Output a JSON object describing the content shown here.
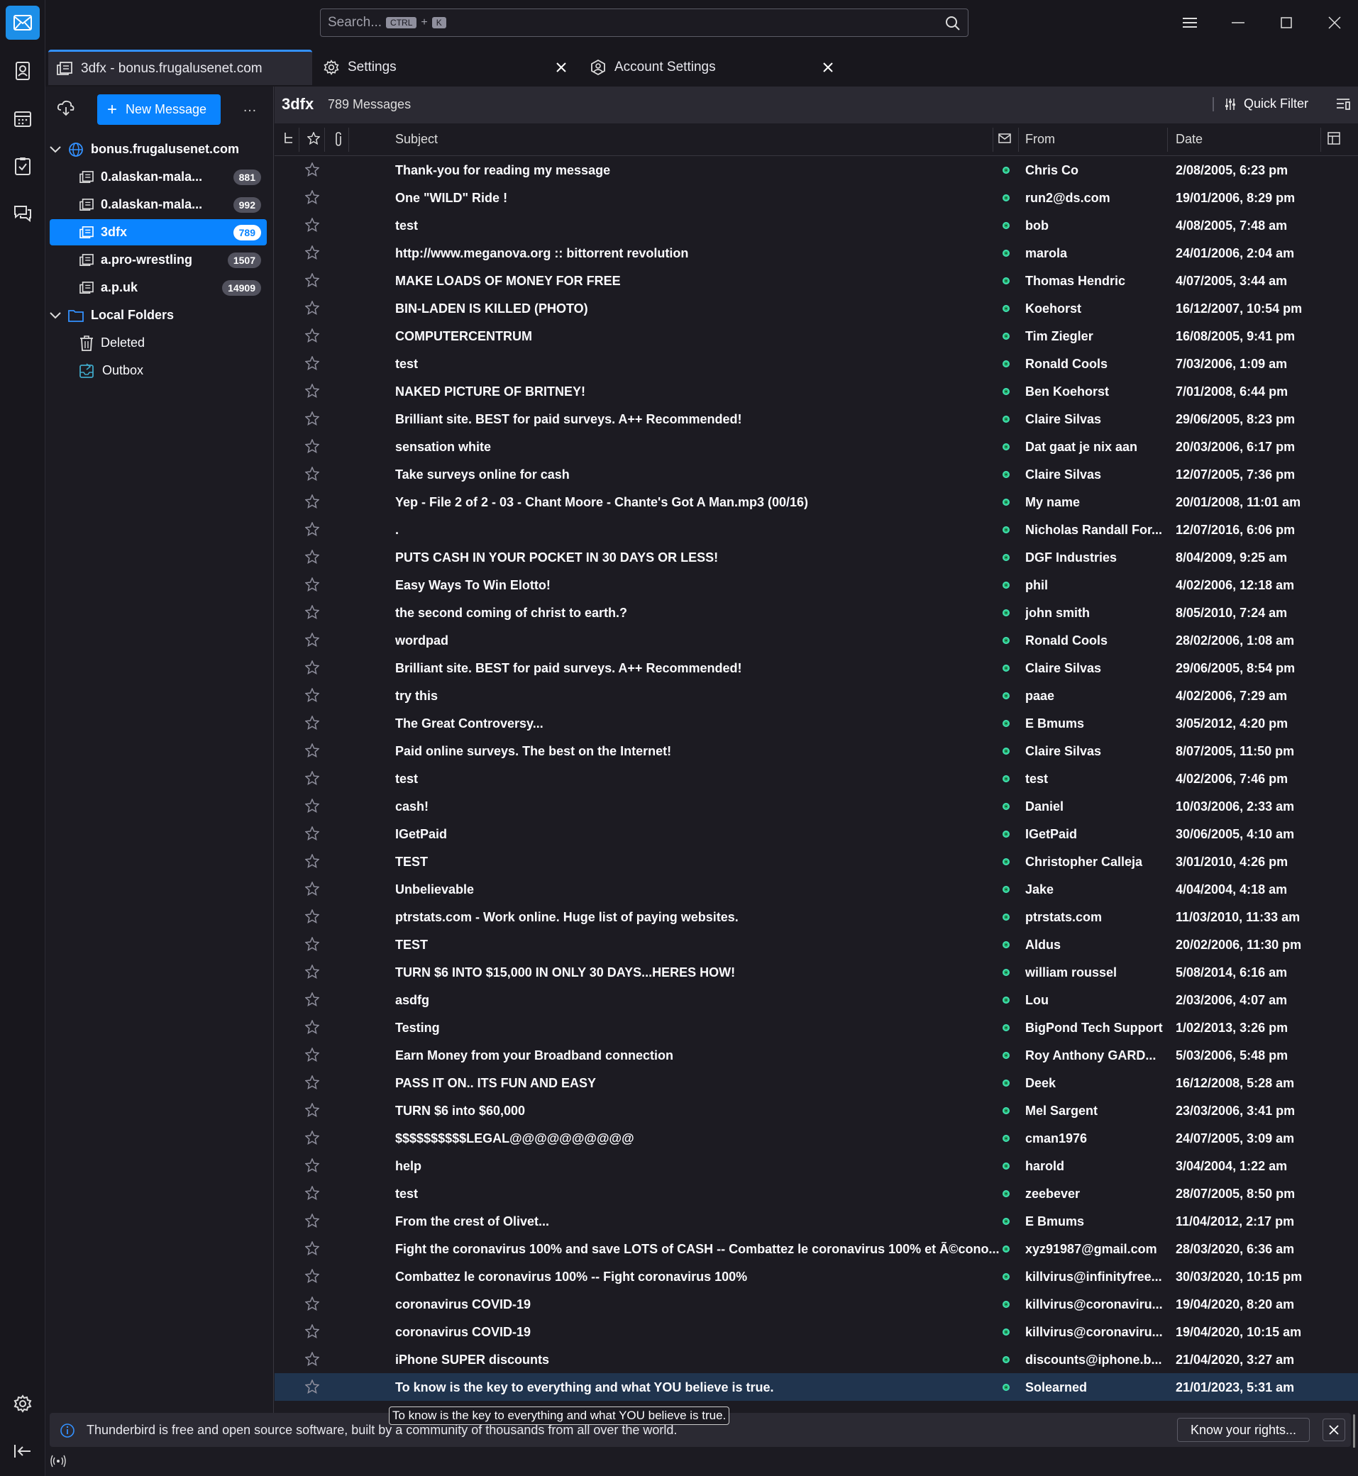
{
  "search": {
    "placeholder": "Search...",
    "shortcut_mod": "CTRL",
    "shortcut_plus": "+",
    "shortcut_key": "K"
  },
  "tabs": [
    {
      "label": "3dfx - bonus.frugalusenet.com",
      "icon": "newsgroup-icon"
    },
    {
      "label": "Settings",
      "icon": "gear-icon"
    },
    {
      "label": "Account Settings",
      "icon": "account-icon"
    }
  ],
  "folderpane": {
    "new_message": "New Message",
    "more": "…",
    "folders": [
      {
        "label": "bonus.frugalusenet.com",
        "type": "server",
        "bold": true
      },
      {
        "label": "0.alaskan-mala...",
        "badge": "881",
        "bold": true
      },
      {
        "label": "0.alaskan-mala...",
        "badge": "992",
        "bold": true
      },
      {
        "label": "3dfx",
        "badge": "789",
        "bold": true,
        "selected": true
      },
      {
        "label": "a.pro-wrestling",
        "badge": "1507",
        "bold": true
      },
      {
        "label": "a.p.uk",
        "badge": "14909",
        "bold": true
      },
      {
        "label": "Local Folders",
        "type": "local",
        "bold": true
      },
      {
        "label": "Deleted",
        "type": "trash"
      },
      {
        "label": "Outbox",
        "type": "outbox"
      }
    ]
  },
  "threadpane": {
    "folder_name": "3dfx",
    "message_count": "789 Messages",
    "quick_filter": "Quick Filter",
    "columns": {
      "subject": "Subject",
      "from": "From",
      "date": "Date"
    },
    "messages": [
      {
        "subject": "Thank-you for reading my message",
        "from": "Chris Co",
        "date": "2/08/2005, 6:23 pm"
      },
      {
        "subject": "One \"WILD\" Ride !",
        "from": "run2@ds.com",
        "date": "19/01/2006, 8:29 pm"
      },
      {
        "subject": "test",
        "from": "bob",
        "date": "4/08/2005, 7:48 am"
      },
      {
        "subject": "http://www.meganova.org :: bittorrent revolution",
        "from": "marola",
        "date": "24/01/2006, 2:04 am"
      },
      {
        "subject": "MAKE LOADS OF MONEY FOR FREE",
        "from": "Thomas Hendric",
        "date": "4/07/2005, 3:44 am"
      },
      {
        "subject": "BIN-LADEN IS KILLED (PHOTO)",
        "from": "Koehorst",
        "date": "16/12/2007, 10:54 pm"
      },
      {
        "subject": "COMPUTERCENTRUM",
        "from": "Tim Ziegler",
        "date": "16/08/2005, 9:41 pm"
      },
      {
        "subject": "test",
        "from": "Ronald Cools",
        "date": "7/03/2006, 1:09 am"
      },
      {
        "subject": "NAKED PICTURE OF BRITNEY!",
        "from": "Ben Koehorst",
        "date": "7/01/2008, 6:44 pm"
      },
      {
        "subject": "Brilliant site. BEST for paid surveys. A++ Recommended!",
        "from": "Claire Silvas",
        "date": "29/06/2005, 8:23 pm"
      },
      {
        "subject": "sensation white",
        "from": "Dat gaat je nix aan",
        "date": "20/03/2006, 6:17 pm"
      },
      {
        "subject": "Take surveys online for cash",
        "from": "Claire Silvas",
        "date": "12/07/2005, 7:36 pm"
      },
      {
        "subject": "Yep - File 2 of 2 - 03 - Chant Moore - Chante's Got A Man.mp3 (00/16)",
        "from": "My name",
        "date": "20/01/2008, 11:01 am"
      },
      {
        "subject": ".",
        "from": "Nicholas Randall For...",
        "date": "12/07/2016, 6:06 pm"
      },
      {
        "subject": "PUTS CASH IN YOUR POCKET IN 30 DAYS OR LESS!",
        "from": "DGF Industries",
        "date": "8/04/2009, 9:25 am"
      },
      {
        "subject": "Easy Ways To Win Elotto!",
        "from": "phil",
        "date": "4/02/2006, 12:18 am"
      },
      {
        "subject": "the second coming of christ to earth.?",
        "from": "john smith",
        "date": "8/05/2010, 7:24 am"
      },
      {
        "subject": "wordpad",
        "from": "Ronald Cools",
        "date": "28/02/2006, 1:08 am"
      },
      {
        "subject": "Brilliant site. BEST for paid surveys. A++ Recommended!",
        "from": "Claire Silvas",
        "date": "29/06/2005, 8:54 pm"
      },
      {
        "subject": "try this",
        "from": "paae",
        "date": "4/02/2006, 7:29 am"
      },
      {
        "subject": "The Great Controversy...",
        "from": "E Bmums",
        "date": "3/05/2012, 4:20 pm"
      },
      {
        "subject": "Paid online surveys. The best on the Internet!",
        "from": "Claire Silvas",
        "date": "8/07/2005, 11:50 pm"
      },
      {
        "subject": "test",
        "from": "test",
        "date": "4/02/2006, 7:46 pm"
      },
      {
        "subject": "cash!",
        "from": "Daniel",
        "date": "10/03/2006, 2:33 am"
      },
      {
        "subject": "IGetPaid",
        "from": "IGetPaid",
        "date": "30/06/2005, 4:10 am"
      },
      {
        "subject": "TEST",
        "from": "Christopher Calleja",
        "date": "3/01/2010, 4:26 pm"
      },
      {
        "subject": "Unbelievable",
        "from": "Jake",
        "date": "4/04/2004, 4:18 am"
      },
      {
        "subject": "ptrstats.com - Work online. Huge list of paying websites.",
        "from": "ptrstats.com",
        "date": "11/03/2010, 11:33 am"
      },
      {
        "subject": "TEST",
        "from": "Aldus",
        "date": "20/02/2006, 11:30 pm"
      },
      {
        "subject": "TURN $6 INTO $15,000 IN ONLY 30 DAYS...HERES HOW!",
        "from": "william roussel",
        "date": "5/08/2014, 6:16 am"
      },
      {
        "subject": "asdfg",
        "from": "Lou",
        "date": "2/03/2006, 4:07 am"
      },
      {
        "subject": "Testing",
        "from": "BigPond Tech Support",
        "date": "1/02/2013, 3:26 pm"
      },
      {
        "subject": "Earn Money from your Broadband connection",
        "from": "Roy Anthony GARD...",
        "date": "5/03/2006, 5:48 pm"
      },
      {
        "subject": "PASS IT ON.. ITS FUN AND EASY",
        "from": "Deek",
        "date": "16/12/2008, 5:28 am"
      },
      {
        "subject": "TURN $6 into $60,000",
        "from": "Mel Sargent",
        "date": "23/03/2006, 3:41 pm"
      },
      {
        "subject": "$$$$$$$$$$LEGAL@@@@@@@@@@",
        "from": "cman1976",
        "date": "24/07/2005, 3:09 am"
      },
      {
        "subject": "help",
        "from": "harold",
        "date": "3/04/2004, 1:22 am"
      },
      {
        "subject": "test",
        "from": "zeebever",
        "date": "28/07/2005, 8:50 pm"
      },
      {
        "subject": "From the crest of Olivet...",
        "from": "E Bmums",
        "date": "11/04/2012, 2:17 pm"
      },
      {
        "subject": "Fight the coronavirus 100% and save LOTS of CASH -- Combattez le coronavirus 100% et Ã©cono...",
        "from": "xyz91987@gmail.com",
        "date": "28/03/2020, 6:36 am"
      },
      {
        "subject": "Combattez le coronavirus 100% -- Fight coronavirus 100%",
        "from": "killvirus@infinityfree...",
        "date": "30/03/2020, 10:15 pm"
      },
      {
        "subject": "coronavirus COVID-19",
        "from": "killvirus@coronaviru...",
        "date": "19/04/2020, 8:20 am"
      },
      {
        "subject": "coronavirus COVID-19",
        "from": "killvirus@coronaviru...",
        "date": "19/04/2020, 10:15 am"
      },
      {
        "subject": "iPhone SUPER discounts",
        "from": "discounts@iphone.b...",
        "date": "21/04/2020, 3:27 am"
      },
      {
        "subject": "To know is the key to everything and what YOU believe is true.",
        "from": "Solearned",
        "date": "21/01/2023, 5:31 am",
        "selected": true
      }
    ]
  },
  "tooltip": "To know is the key to everything and what YOU believe is true.",
  "notification": {
    "text": "Thunderbird is free and open source software, built by a community of thousands from all over the world.",
    "button": "Know your rights..."
  },
  "colors": {
    "accent": "#0a84ff",
    "selected_row": "#20344e",
    "background": "#1c1b22"
  }
}
